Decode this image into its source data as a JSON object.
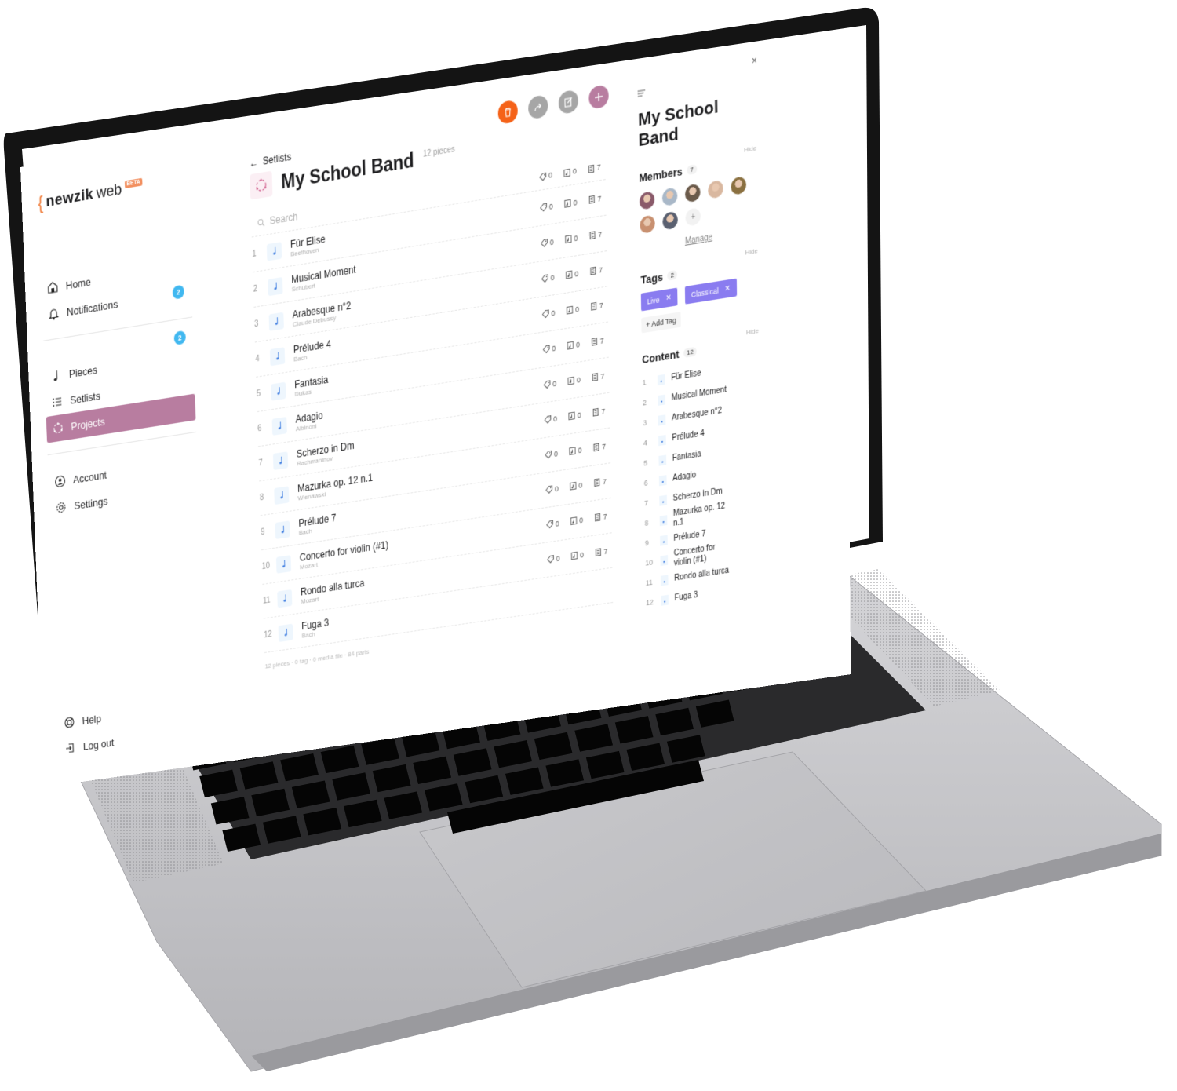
{
  "device": {
    "type": "laptop",
    "body_color": "#c8c8cc",
    "bezel_color": "#111111"
  },
  "sidebar": {
    "logo": {
      "brace": "{",
      "bold": "newzik",
      "light": "web",
      "badge": "BETA"
    },
    "primary": [
      {
        "label": "Home",
        "icon": "home-icon"
      },
      {
        "label": "Notifications",
        "icon": "bell-icon",
        "badge": "2"
      }
    ],
    "library": [
      {
        "label": "Pieces",
        "icon": "music-note-icon",
        "badge": "2"
      },
      {
        "label": "Setlists",
        "icon": "list-icon"
      },
      {
        "label": "Projects",
        "icon": "project-icon",
        "active": true
      }
    ],
    "account": [
      {
        "label": "Account",
        "icon": "user-icon"
      },
      {
        "label": "Settings",
        "icon": "gear-icon"
      }
    ],
    "bottom": [
      {
        "label": "Help",
        "icon": "lifebuoy-icon"
      },
      {
        "label": "Log out",
        "icon": "logout-icon"
      }
    ]
  },
  "main": {
    "back_label": "Setlists",
    "title": "My School Band",
    "piece_count": "12 pieces",
    "search_placeholder": "Search",
    "totals": {
      "tags": "0",
      "media": "0",
      "parts": "7"
    },
    "actions": {
      "delete": "delete",
      "share": "share",
      "edit": "edit",
      "add": "add"
    },
    "colors": {
      "delete": "#f56218",
      "neutral": "#a6a6a6",
      "accent": "#b87da0"
    },
    "pieces": [
      {
        "num": "1",
        "title": "Für Elise",
        "composer": "Beethoven",
        "tags": "0",
        "media": "0",
        "parts": "7"
      },
      {
        "num": "2",
        "title": "Musical Moment",
        "composer": "Schubert",
        "tags": "0",
        "media": "0",
        "parts": "7"
      },
      {
        "num": "3",
        "title": "Arabesque n°2",
        "composer": "Claude Debussy",
        "tags": "0",
        "media": "0",
        "parts": "7"
      },
      {
        "num": "4",
        "title": "Prélude 4",
        "composer": "Bach",
        "tags": "0",
        "media": "0",
        "parts": "7"
      },
      {
        "num": "5",
        "title": "Fantasia",
        "composer": "Dukas",
        "tags": "0",
        "media": "0",
        "parts": "7"
      },
      {
        "num": "6",
        "title": "Adagio",
        "composer": "Albinoni",
        "tags": "0",
        "media": "0",
        "parts": "7"
      },
      {
        "num": "7",
        "title": "Scherzo in Dm",
        "composer": "Rachmaninov",
        "tags": "0",
        "media": "0",
        "parts": "7"
      },
      {
        "num": "8",
        "title": "Mazurka op. 12  n.1",
        "composer": "Wienawski",
        "tags": "0",
        "media": "0",
        "parts": "7"
      },
      {
        "num": "9",
        "title": "Prélude 7",
        "composer": "Bach",
        "tags": "0",
        "media": "0",
        "parts": "7"
      },
      {
        "num": "10",
        "title": "Concerto for violin (#1)",
        "composer": "Mozart",
        "tags": "0",
        "media": "0",
        "parts": "7"
      },
      {
        "num": "11",
        "title": "Rondo alla turca",
        "composer": "Mozart",
        "tags": "0",
        "media": "0",
        "parts": "7"
      },
      {
        "num": "12",
        "title": "Fuga 3",
        "composer": "Bach",
        "tags": "",
        "media": "",
        "parts": ""
      }
    ],
    "footer": "12 pieces · 0 tag · 0 media file · 84 parts"
  },
  "panel": {
    "close": "×",
    "title": "My School Band",
    "hide_label": "Hide",
    "members": {
      "label": "Members",
      "count": "7",
      "avatars": [
        "#8a5a6a",
        "#a9b8c8",
        "#6a5a4a",
        "#d9b8a0",
        "#8a7040",
        "#c89070",
        "#5a6070"
      ],
      "add": "+",
      "manage": "Manage"
    },
    "tags": {
      "label": "Tags",
      "count": "2",
      "items": [
        "Live",
        "Classical"
      ],
      "color": "#8a7cf0",
      "add_label": "Add Tag"
    },
    "content": {
      "label": "Content",
      "count": "12",
      "items": [
        {
          "num": "1",
          "title": "Für Elise"
        },
        {
          "num": "2",
          "title": "Musical Moment"
        },
        {
          "num": "3",
          "title": "Arabesque n°2"
        },
        {
          "num": "4",
          "title": "Prélude 4"
        },
        {
          "num": "5",
          "title": "Fantasia"
        },
        {
          "num": "6",
          "title": "Adagio"
        },
        {
          "num": "7",
          "title": "Scherzo in Dm"
        },
        {
          "num": "8",
          "title": "Mazurka op. 12 n.1"
        },
        {
          "num": "9",
          "title": "Prélude 7"
        },
        {
          "num": "10",
          "title": "Concerto for violin (#1)"
        },
        {
          "num": "11",
          "title": "Rondo alla turca"
        },
        {
          "num": "12",
          "title": "Fuga 3"
        }
      ]
    }
  }
}
